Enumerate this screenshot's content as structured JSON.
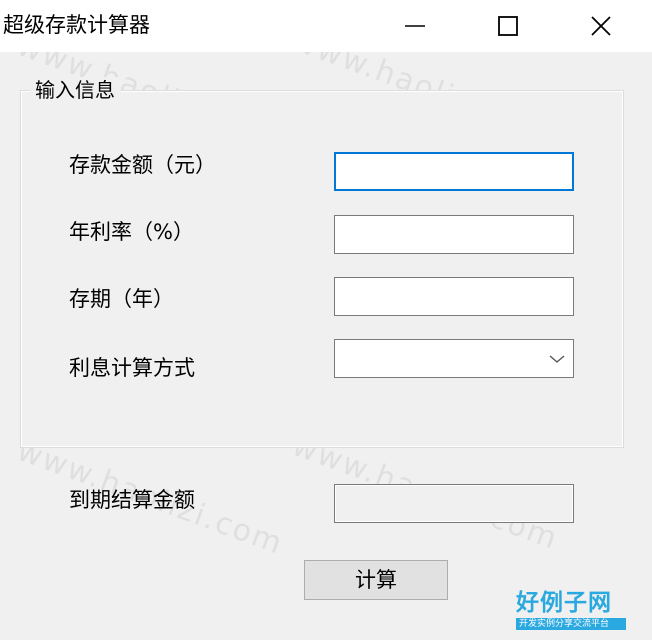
{
  "window": {
    "title": "超级存款计算器",
    "controls": [
      "minimize-icon",
      "maximize-icon",
      "close-icon"
    ]
  },
  "group": {
    "legend": "输入信息",
    "fields": [
      {
        "label": "存款金额（元）",
        "value": ""
      },
      {
        "label": "年利率（%）",
        "value": ""
      },
      {
        "label": "存期（年）",
        "value": ""
      }
    ],
    "method": {
      "label": "利息计算方式",
      "selected": ""
    }
  },
  "result": {
    "label": "到期结算金额",
    "value": ""
  },
  "calc_button": "计算",
  "watermark": "www.haolizi.com",
  "logo": {
    "title": "好例子网",
    "subtitle": "开发实例分享交流平台"
  },
  "colors": {
    "accent": "#0078d7",
    "logo": "#2aa8e0"
  }
}
